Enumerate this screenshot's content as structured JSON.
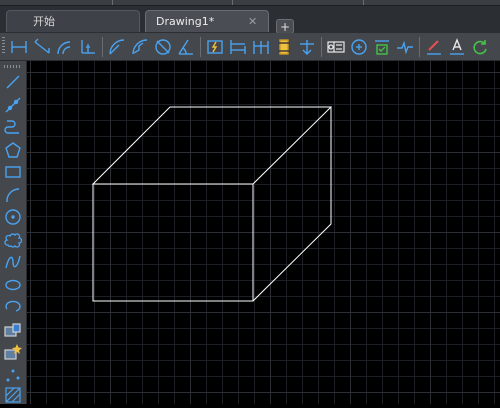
{
  "tabs": {
    "home_label": "开始",
    "drawing_label": "Drawing1*",
    "close_glyph": "✕",
    "add_glyph": "+"
  },
  "toolbar": {
    "icons": [
      "linear-dimension",
      "aligned-dimension",
      "arc-length-dimension",
      "ordinate-dimension",
      "radius-dimension",
      "jogged-dimension",
      "diameter-dimension",
      "angular-dimension",
      "quick-dimension",
      "baseline-dimension",
      "continue-dimension",
      "dimension-space",
      "dimension-break",
      "tolerance",
      "center-mark",
      "inspection",
      "jogged-linear",
      "dimension-edit",
      "dimension-text-edit",
      "dimension-update"
    ]
  },
  "sidebar": {
    "icons": [
      "line",
      "construction-line",
      "polyline",
      "polygon",
      "rectangle",
      "arc",
      "circle",
      "revision-cloud",
      "spline",
      "ellipse",
      "ellipse-arc",
      "insert-block",
      "make-block",
      "point",
      "hatch"
    ]
  },
  "colors": {
    "canvas_bg": "#000000",
    "grid_minor": "#1c1f23",
    "grid_major": "#2b2f34",
    "drawing_stroke": "#ffffff",
    "icon_blue": "#4aa3f0"
  },
  "drawing": {
    "shape": "box",
    "note": ""
  }
}
